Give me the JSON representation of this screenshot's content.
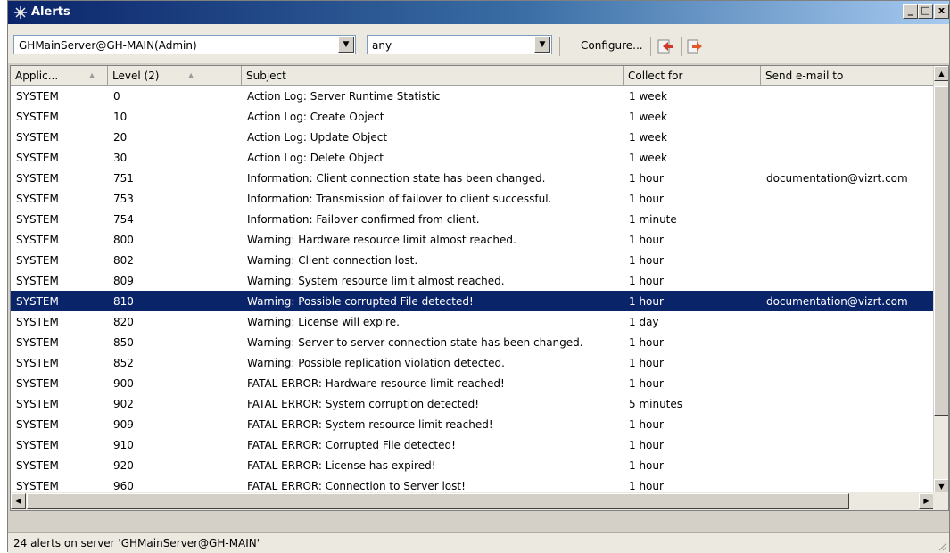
{
  "window": {
    "title": "Alerts",
    "controls": {
      "minimize": "_",
      "maximize": "□",
      "close": "x"
    }
  },
  "toolbar": {
    "server_combo": {
      "value": "GHMainServer@GH-MAIN(Admin)"
    },
    "filter_combo": {
      "value": "any"
    },
    "configure_label": "Configure...",
    "icons": [
      "connect-icon",
      "disconnect-icon"
    ]
  },
  "grid": {
    "columns": [
      "Applic...",
      "Level (2)",
      "Subject",
      "Collect for",
      "Send e-mail to"
    ],
    "sorted_columns": [
      0,
      1
    ],
    "selected_row": 10,
    "rows": [
      [
        "SYSTEM",
        "0",
        "Action Log: Server Runtime Statistic",
        "1 week",
        ""
      ],
      [
        "SYSTEM",
        "10",
        "Action Log: Create Object",
        "1 week",
        ""
      ],
      [
        "SYSTEM",
        "20",
        "Action Log: Update Object",
        "1 week",
        ""
      ],
      [
        "SYSTEM",
        "30",
        "Action Log: Delete Object",
        "1 week",
        ""
      ],
      [
        "SYSTEM",
        "751",
        "Information: Client connection state has been changed.",
        "1 hour",
        "documentation@vizrt.com"
      ],
      [
        "SYSTEM",
        "753",
        "Information: Transmission of failover to client successful.",
        "1 hour",
        ""
      ],
      [
        "SYSTEM",
        "754",
        "Information: Failover confirmed from client.",
        "1 minute",
        ""
      ],
      [
        "SYSTEM",
        "800",
        "Warning: Hardware resource limit almost reached.",
        "1 hour",
        ""
      ],
      [
        "SYSTEM",
        "802",
        "Warning: Client connection lost.",
        "1 hour",
        ""
      ],
      [
        "SYSTEM",
        "809",
        "Warning: System resource limit almost reached.",
        "1 hour",
        ""
      ],
      [
        "SYSTEM",
        "810",
        "Warning: Possible corrupted File detected!",
        "1 hour",
        "documentation@vizrt.com"
      ],
      [
        "SYSTEM",
        "820",
        "Warning: License will expire.",
        "1 day",
        ""
      ],
      [
        "SYSTEM",
        "850",
        "Warning: Server to server connection state has been changed.",
        "1 hour",
        ""
      ],
      [
        "SYSTEM",
        "852",
        "Warning: Possible replication violation detected.",
        "1 hour",
        ""
      ],
      [
        "SYSTEM",
        "900",
        "FATAL ERROR: Hardware resource limit reached!",
        "1 hour",
        ""
      ],
      [
        "SYSTEM",
        "902",
        "FATAL ERROR: System corruption detected!",
        "5 minutes",
        ""
      ],
      [
        "SYSTEM",
        "909",
        "FATAL ERROR: System resource limit reached!",
        "1 hour",
        ""
      ],
      [
        "SYSTEM",
        "910",
        "FATAL ERROR: Corrupted File detected!",
        "1 hour",
        ""
      ],
      [
        "SYSTEM",
        "920",
        "FATAL ERROR: License has expired!",
        "1 hour",
        ""
      ],
      [
        "SYSTEM",
        "960",
        "FATAL ERROR: Connection to Server lost!",
        "1 hour",
        ""
      ]
    ]
  },
  "statusbar": {
    "text": "24 alerts on server 'GHMainServer@GH-MAIN'"
  },
  "colors": {
    "selection": "#0a246a",
    "title_start": "#0a246a",
    "title_end": "#a6caf0"
  }
}
